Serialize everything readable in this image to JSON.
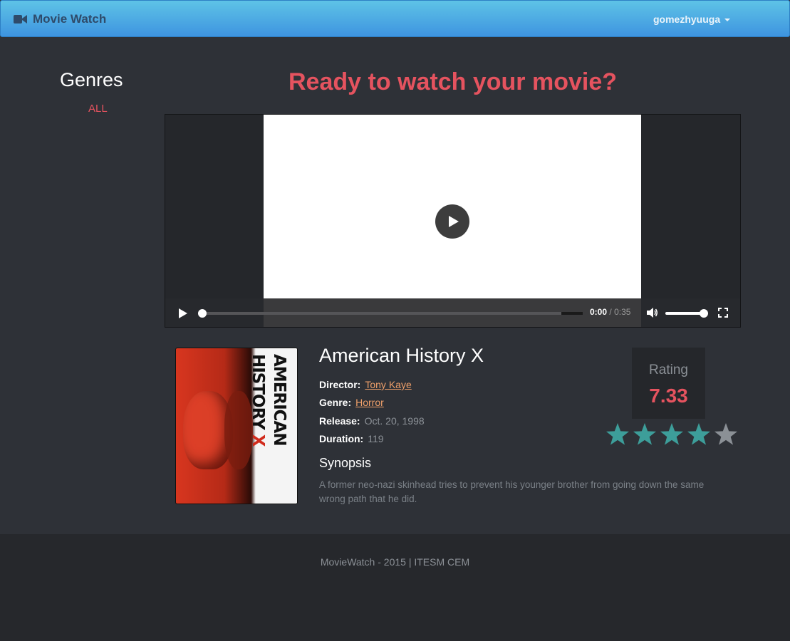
{
  "navbar": {
    "brand": "Movie Watch",
    "brand_icon": "video-camera-icon",
    "username": "gomezhyuuga"
  },
  "sidebar": {
    "title": "Genres",
    "items": [
      {
        "label": "ALL"
      }
    ]
  },
  "main": {
    "heading": "Ready to watch your movie?"
  },
  "player": {
    "current_time": "0:00",
    "separator": "/",
    "duration": "0:35",
    "progress": 0,
    "volume": 1.0
  },
  "movie": {
    "title": "American History X",
    "poster_text": "AMERICAN HISTORY",
    "poster_x": "X",
    "director_label": "Director:",
    "director": "Tony Kaye",
    "genre_label": "Genre:",
    "genre": "Horror",
    "release_label": "Release:",
    "release": "Oct. 20, 1998",
    "duration_label": "Duration:",
    "duration": "119",
    "synopsis_title": "Synopsis",
    "synopsis": "A former neo-nazi skinhead tries to prevent his younger brother from going down the same wrong path that he did."
  },
  "rating": {
    "label": "Rating",
    "value": "7.33",
    "stars_filled": 4,
    "stars_total": 5,
    "star_color": "#3d9e9a",
    "star_empty_color": "#8b9096"
  },
  "footer": {
    "text": "MovieWatch - 2015 | ITESM CEM"
  },
  "colors": {
    "accent": "#e5535f",
    "link": "#f0a06a",
    "navbar_top": "#5ec3e6",
    "navbar_bottom": "#3e94e0"
  }
}
